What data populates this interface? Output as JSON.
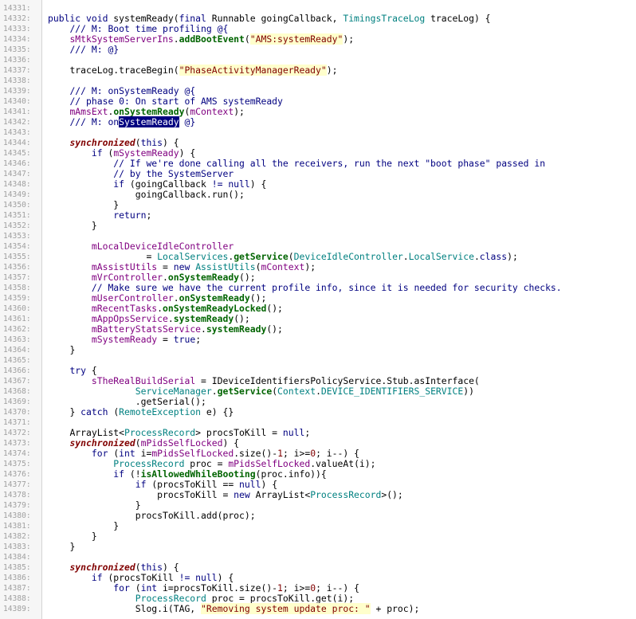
{
  "editor": {
    "theme": {
      "background": "#ffffff",
      "gutter": "#f6f6f6",
      "line_number": "#a0a0a0",
      "keyword": "#000080",
      "modifier_keyword": "#800000",
      "type": "#008080",
      "method": "#006400",
      "comment": "#000080",
      "member": "#800080",
      "string": "#800000",
      "string_highlight": "#ffffcc",
      "selection": "#000080"
    },
    "selected_text": "SystemReady",
    "lines": [
      {
        "n": "14331:",
        "indent": 0,
        "tokens": []
      },
      {
        "n": "14332:",
        "indent": 1,
        "tokens": [
          [
            "kw",
            "public void "
          ],
          [
            "",
            "systemReady("
          ],
          [
            "kw",
            "final "
          ],
          [
            "",
            "Runnable goingCallback, "
          ],
          [
            "ty",
            "TimingsTraceLog"
          ],
          [
            "",
            " traceLog) {"
          ]
        ]
      },
      {
        "n": "14333:",
        "indent": 2,
        "tokens": [
          [
            "cm",
            "/// M: Boot time profiling @{"
          ]
        ]
      },
      {
        "n": "14334:",
        "indent": 2,
        "tokens": [
          [
            "ms",
            "sMtkSystemServerIns"
          ],
          [
            "",
            "."
          ],
          [
            "fn",
            "addBootEvent"
          ],
          [
            "",
            "("
          ],
          [
            "str",
            "\"AMS:systemReady\""
          ],
          [
            "",
            ");"
          ]
        ]
      },
      {
        "n": "14335:",
        "indent": 2,
        "tokens": [
          [
            "cm",
            "/// M: @}"
          ]
        ]
      },
      {
        "n": "14336:",
        "indent": 0,
        "tokens": []
      },
      {
        "n": "14337:",
        "indent": 2,
        "tokens": [
          [
            "",
            "traceLog.traceBegin("
          ],
          [
            "str",
            "\"PhaseActivityManagerReady\""
          ],
          [
            "",
            ");"
          ]
        ]
      },
      {
        "n": "14338:",
        "indent": 0,
        "tokens": []
      },
      {
        "n": "14339:",
        "indent": 2,
        "tokens": [
          [
            "cm",
            "/// M: onSystemReady @{"
          ]
        ]
      },
      {
        "n": "14340:",
        "indent": 2,
        "tokens": [
          [
            "cm",
            "// phase 0: On start of AMS systemReady"
          ]
        ]
      },
      {
        "n": "14341:",
        "indent": 2,
        "tokens": [
          [
            "ms",
            "mAmsExt"
          ],
          [
            "",
            "."
          ],
          [
            "fn",
            "onSystemReady"
          ],
          [
            "",
            "("
          ],
          [
            "ms",
            "mContext"
          ],
          [
            "",
            ");"
          ]
        ]
      },
      {
        "n": "14342:",
        "indent": 2,
        "tokens": [
          [
            "cm",
            "/// M: on"
          ],
          [
            "sel",
            "SystemReady"
          ],
          [
            "cm",
            " @}"
          ]
        ]
      },
      {
        "n": "14343:",
        "indent": 0,
        "tokens": []
      },
      {
        "n": "14344:",
        "indent": 2,
        "tokens": [
          [
            "kwi",
            "synchronized"
          ],
          [
            "",
            "("
          ],
          [
            "kw",
            "this"
          ],
          [
            "",
            ") {"
          ]
        ]
      },
      {
        "n": "14345:",
        "indent": 3,
        "tokens": [
          [
            "kw",
            "if "
          ],
          [
            "",
            "("
          ],
          [
            "ms",
            "mSystemReady"
          ],
          [
            "",
            ") {"
          ]
        ]
      },
      {
        "n": "14346:",
        "indent": 4,
        "tokens": [
          [
            "cm",
            "// If we're done calling all the receivers, run the next \"boot phase\" passed in"
          ]
        ]
      },
      {
        "n": "14347:",
        "indent": 4,
        "tokens": [
          [
            "cm",
            "// by the SystemServer"
          ]
        ]
      },
      {
        "n": "14348:",
        "indent": 4,
        "tokens": [
          [
            "kw",
            "if "
          ],
          [
            "",
            "(goingCallback "
          ],
          [
            "kw",
            "!= null"
          ],
          [
            "",
            ") {"
          ]
        ]
      },
      {
        "n": "14349:",
        "indent": 5,
        "tokens": [
          [
            "",
            "goingCallback.run();"
          ]
        ]
      },
      {
        "n": "14350:",
        "indent": 4,
        "tokens": [
          [
            "",
            "}"
          ]
        ]
      },
      {
        "n": "14351:",
        "indent": 4,
        "tokens": [
          [
            "kw",
            "return"
          ],
          [
            "",
            ";"
          ]
        ]
      },
      {
        "n": "14352:",
        "indent": 3,
        "tokens": [
          [
            "",
            "}"
          ]
        ]
      },
      {
        "n": "14353:",
        "indent": 0,
        "tokens": []
      },
      {
        "n": "14354:",
        "indent": 3,
        "tokens": [
          [
            "ms",
            "mLocalDeviceIdleController"
          ]
        ]
      },
      {
        "n": "14355:",
        "indent": 5,
        "pad": 2,
        "tokens": [
          [
            "",
            "= "
          ],
          [
            "ty",
            "LocalServices"
          ],
          [
            "",
            "."
          ],
          [
            "fn",
            "getService"
          ],
          [
            "",
            "("
          ],
          [
            "ty",
            "DeviceIdleController"
          ],
          [
            "",
            "."
          ],
          [
            "ty",
            "LocalService"
          ],
          [
            "",
            "."
          ],
          [
            "kw",
            "class"
          ],
          [
            "",
            ");"
          ]
        ]
      },
      {
        "n": "14356:",
        "indent": 3,
        "tokens": [
          [
            "ms",
            "mAssistUtils"
          ],
          [
            "",
            " = "
          ],
          [
            "kw",
            "new "
          ],
          [
            "ty",
            "AssistUtils"
          ],
          [
            "",
            "("
          ],
          [
            "ms",
            "mContext"
          ],
          [
            "",
            ");"
          ]
        ]
      },
      {
        "n": "14357:",
        "indent": 3,
        "tokens": [
          [
            "ms",
            "mVrController"
          ],
          [
            "",
            "."
          ],
          [
            "fn",
            "onSystemReady"
          ],
          [
            "",
            "();"
          ]
        ]
      },
      {
        "n": "14358:",
        "indent": 3,
        "tokens": [
          [
            "cm",
            "// Make sure we have the current profile info, since it is needed for security checks."
          ]
        ]
      },
      {
        "n": "14359:",
        "indent": 3,
        "tokens": [
          [
            "ms",
            "mUserController"
          ],
          [
            "",
            "."
          ],
          [
            "fn",
            "onSystemReady"
          ],
          [
            "",
            "();"
          ]
        ]
      },
      {
        "n": "14360:",
        "indent": 3,
        "tokens": [
          [
            "ms",
            "mRecentTasks"
          ],
          [
            "",
            "."
          ],
          [
            "fn",
            "onSystemReadyLocked"
          ],
          [
            "",
            "();"
          ]
        ]
      },
      {
        "n": "14361:",
        "indent": 3,
        "tokens": [
          [
            "ms",
            "mAppOpsService"
          ],
          [
            "",
            "."
          ],
          [
            "fn",
            "systemReady"
          ],
          [
            "",
            "();"
          ]
        ]
      },
      {
        "n": "14362:",
        "indent": 3,
        "tokens": [
          [
            "ms",
            "mBatteryStatsService"
          ],
          [
            "",
            "."
          ],
          [
            "fn",
            "systemReady"
          ],
          [
            "",
            "();"
          ]
        ]
      },
      {
        "n": "14363:",
        "indent": 3,
        "tokens": [
          [
            "ms",
            "mSystemReady"
          ],
          [
            "",
            " = "
          ],
          [
            "kw",
            "true"
          ],
          [
            "",
            ";"
          ]
        ]
      },
      {
        "n": "14364:",
        "indent": 2,
        "tokens": [
          [
            "",
            "}"
          ]
        ]
      },
      {
        "n": "14365:",
        "indent": 0,
        "tokens": []
      },
      {
        "n": "14366:",
        "indent": 2,
        "tokens": [
          [
            "kw",
            "try "
          ],
          [
            "",
            "{"
          ]
        ]
      },
      {
        "n": "14367:",
        "indent": 3,
        "tokens": [
          [
            "ms",
            "sTheRealBuildSerial"
          ],
          [
            "",
            " = IDeviceIdentifiersPolicyService.Stub.asInterface("
          ]
        ]
      },
      {
        "n": "14368:",
        "indent": 5,
        "tokens": [
          [
            "ty",
            "ServiceManager"
          ],
          [
            "",
            "."
          ],
          [
            "fn",
            "getService"
          ],
          [
            "",
            "("
          ],
          [
            "ty",
            "Context"
          ],
          [
            "",
            "."
          ],
          [
            "ty",
            "DEVICE_IDENTIFIERS_SERVICE"
          ],
          [
            "",
            "))"
          ]
        ]
      },
      {
        "n": "14369:",
        "indent": 5,
        "tokens": [
          [
            "",
            ".getSerial();"
          ]
        ]
      },
      {
        "n": "14370:",
        "indent": 2,
        "tokens": [
          [
            "",
            "} "
          ],
          [
            "kw",
            "catch "
          ],
          [
            "",
            "("
          ],
          [
            "ty",
            "RemoteException"
          ],
          [
            "",
            " e) {}"
          ]
        ]
      },
      {
        "n": "14371:",
        "indent": 0,
        "tokens": []
      },
      {
        "n": "14372:",
        "indent": 2,
        "tokens": [
          [
            "",
            "ArrayList<"
          ],
          [
            "ty",
            "ProcessRecord"
          ],
          [
            "",
            "> procsToKill = "
          ],
          [
            "kw",
            "null"
          ],
          [
            "",
            ";"
          ]
        ]
      },
      {
        "n": "14373:",
        "indent": 2,
        "tokens": [
          [
            "kwi",
            "synchronized"
          ],
          [
            "",
            "("
          ],
          [
            "ms",
            "mPidsSelfLocked"
          ],
          [
            "",
            ") {"
          ]
        ]
      },
      {
        "n": "14374:",
        "indent": 3,
        "tokens": [
          [
            "kw",
            "for "
          ],
          [
            "",
            "("
          ],
          [
            "kw",
            "int "
          ],
          [
            "",
            "i="
          ],
          [
            "ms",
            "mPidsSelfLocked"
          ],
          [
            "",
            ".size()-"
          ],
          [
            "num",
            "1"
          ],
          [
            "",
            "; i>="
          ],
          [
            "num",
            "0"
          ],
          [
            "",
            "; i--) {"
          ]
        ]
      },
      {
        "n": "14375:",
        "indent": 4,
        "tokens": [
          [
            "ty",
            "ProcessRecord"
          ],
          [
            "",
            " proc = "
          ],
          [
            "ms",
            "mPidsSelfLocked"
          ],
          [
            "",
            ".valueAt(i);"
          ]
        ]
      },
      {
        "n": "14376:",
        "indent": 4,
        "tokens": [
          [
            "kw",
            "if "
          ],
          [
            "",
            "(!"
          ],
          [
            "fn",
            "isAllowedWhileBooting"
          ],
          [
            "",
            "(proc.info)){"
          ]
        ]
      },
      {
        "n": "14377:",
        "indent": 5,
        "tokens": [
          [
            "kw",
            "if "
          ],
          [
            "",
            "(procsToKill == "
          ],
          [
            "kw",
            "null"
          ],
          [
            "",
            ") {"
          ]
        ]
      },
      {
        "n": "14378:",
        "indent": 6,
        "tokens": [
          [
            "",
            "procsToKill = "
          ],
          [
            "kw",
            "new "
          ],
          [
            "",
            "ArrayList<"
          ],
          [
            "ty",
            "ProcessRecord"
          ],
          [
            "",
            ">();"
          ]
        ]
      },
      {
        "n": "14379:",
        "indent": 5,
        "tokens": [
          [
            "",
            "}"
          ]
        ]
      },
      {
        "n": "14380:",
        "indent": 5,
        "tokens": [
          [
            "",
            "procsToKill.add(proc);"
          ]
        ]
      },
      {
        "n": "14381:",
        "indent": 4,
        "tokens": [
          [
            "",
            "}"
          ]
        ]
      },
      {
        "n": "14382:",
        "indent": 3,
        "tokens": [
          [
            "",
            "}"
          ]
        ]
      },
      {
        "n": "14383:",
        "indent": 2,
        "tokens": [
          [
            "",
            "}"
          ]
        ]
      },
      {
        "n": "14384:",
        "indent": 0,
        "tokens": []
      },
      {
        "n": "14385:",
        "indent": 2,
        "tokens": [
          [
            "kwi",
            "synchronized"
          ],
          [
            "",
            "("
          ],
          [
            "kw",
            "this"
          ],
          [
            "",
            ") {"
          ]
        ]
      },
      {
        "n": "14386:",
        "indent": 3,
        "tokens": [
          [
            "kw",
            "if "
          ],
          [
            "",
            "(procsToKill "
          ],
          [
            "kw",
            "!= null"
          ],
          [
            "",
            ") {"
          ]
        ]
      },
      {
        "n": "14387:",
        "indent": 4,
        "tokens": [
          [
            "kw",
            "for "
          ],
          [
            "",
            "("
          ],
          [
            "kw",
            "int "
          ],
          [
            "",
            "i=procsToKill.size()-"
          ],
          [
            "num",
            "1"
          ],
          [
            "",
            "; i>="
          ],
          [
            "num",
            "0"
          ],
          [
            "",
            "; i--) {"
          ]
        ]
      },
      {
        "n": "14388:",
        "indent": 5,
        "tokens": [
          [
            "ty",
            "ProcessRecord"
          ],
          [
            "",
            " proc = procsToKill.get(i);"
          ]
        ]
      },
      {
        "n": "14389:",
        "indent": 5,
        "tokens": [
          [
            "",
            "Slog.i(TAG, "
          ],
          [
            "str",
            "\"Removing system update proc: \""
          ],
          [
            "",
            " + proc);"
          ]
        ]
      }
    ]
  }
}
